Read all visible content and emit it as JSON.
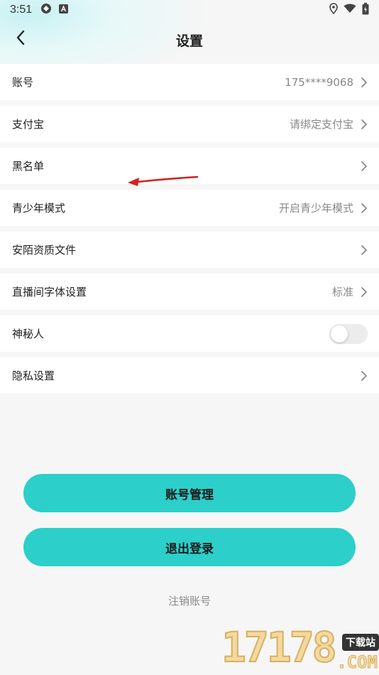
{
  "status_bar": {
    "time": "3:51"
  },
  "header": {
    "title": "设置"
  },
  "settings": {
    "account": {
      "label": "账号",
      "value": "175****9068"
    },
    "alipay": {
      "label": "支付宝",
      "value": "请绑定支付宝"
    },
    "blacklist": {
      "label": "黑名单"
    },
    "youth_mode": {
      "label": "青少年模式",
      "value": "开启青少年模式"
    },
    "qualification": {
      "label": "安陌资质文件"
    },
    "live_font": {
      "label": "直播间字体设置",
      "value": "标准"
    },
    "mystery": {
      "label": "神秘人",
      "toggle": false
    },
    "privacy": {
      "label": "隐私设置"
    }
  },
  "buttons": {
    "account_manage": "账号管理",
    "logout": "退出登录",
    "cancel_account": "注销账号"
  },
  "watermark": {
    "digits": "17178",
    "tag": "下载站",
    "suffix": ".COM"
  },
  "colors": {
    "accent": "#2ccfca",
    "annotation_arrow": "#d42020"
  }
}
